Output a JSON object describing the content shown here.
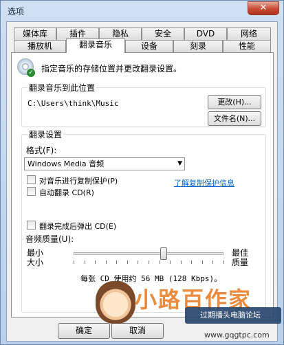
{
  "window": {
    "title": "选项",
    "close_glyph": "✕"
  },
  "tabs_row1": [
    "媒体库",
    "插件",
    "隐私",
    "安全",
    "DVD",
    "网络"
  ],
  "tabs_row2": [
    "播放机",
    "翻录音乐",
    "设备",
    "刻录",
    "性能"
  ],
  "active_tab": "翻录音乐",
  "intro": {
    "icon": "cd-icon",
    "text": "指定音乐的存储位置并更改翻录设置。"
  },
  "rip_location": {
    "title": "翻录音乐到此位置",
    "path": "C:\\Users\\think\\Music",
    "change_button": "更改(H)...",
    "filename_button": "文件名(N)..."
  },
  "rip_settings": {
    "title": "翻录设置",
    "format_label": "格式(F):",
    "format_value": "Windows Media 音频",
    "copy_protect_label": "对音乐进行复制保护(P)",
    "copy_protect_checked": false,
    "learn_link": "了解复制保护信息",
    "auto_rip_label": "自动翻录 CD(R)",
    "auto_rip_checked": false,
    "eject_label": "翻录完成后弹出 CD(E)",
    "eject_checked": false,
    "quality_label": "音频质量(U):",
    "min_label_1": "最小",
    "min_label_2": "大小",
    "max_label_1": "最佳",
    "max_label_2": "质量",
    "quality_level": 0.6,
    "usage_text": "每张 CD 使用约 56 MB (128 Kbps)。"
  },
  "buttons": {
    "ok": "确定",
    "cancel": "取消"
  },
  "watermark": {
    "text": "小路百作家",
    "badge": "过期播头电脑论坛",
    "url": "www.gqgtpc.com"
  }
}
